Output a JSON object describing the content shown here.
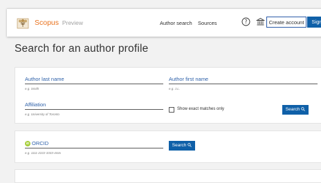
{
  "header": {
    "brand": "Scopus",
    "brand_suffix": "Preview",
    "nav": [
      "Author search",
      "Sources"
    ],
    "create_account": "Create account",
    "sign_in": "Sign in",
    "icons": [
      "help-icon",
      "institution-icon"
    ]
  },
  "page_title": "Search for an author profile",
  "author_form": {
    "last_name_label": "Author last name",
    "last_name_hint": "e.g. Smith",
    "first_name_label": "Author first name",
    "first_name_hint": "e.g. J.L.",
    "affiliation_label": "Affiliation",
    "affiliation_hint": "e.g. University of Toronto",
    "exact_matches_label": "Show exact matches only",
    "search_label": "Search"
  },
  "orcid_form": {
    "badge": "iD",
    "label": "ORCID",
    "hint": "e.g. 1111-2222-3333-444x",
    "search_label": "Search"
  },
  "colors": {
    "accent": "#e9711c",
    "link_blue": "#2c5fa8",
    "button_blue": "#0f60a8",
    "orcid_green": "#a6ce39"
  }
}
